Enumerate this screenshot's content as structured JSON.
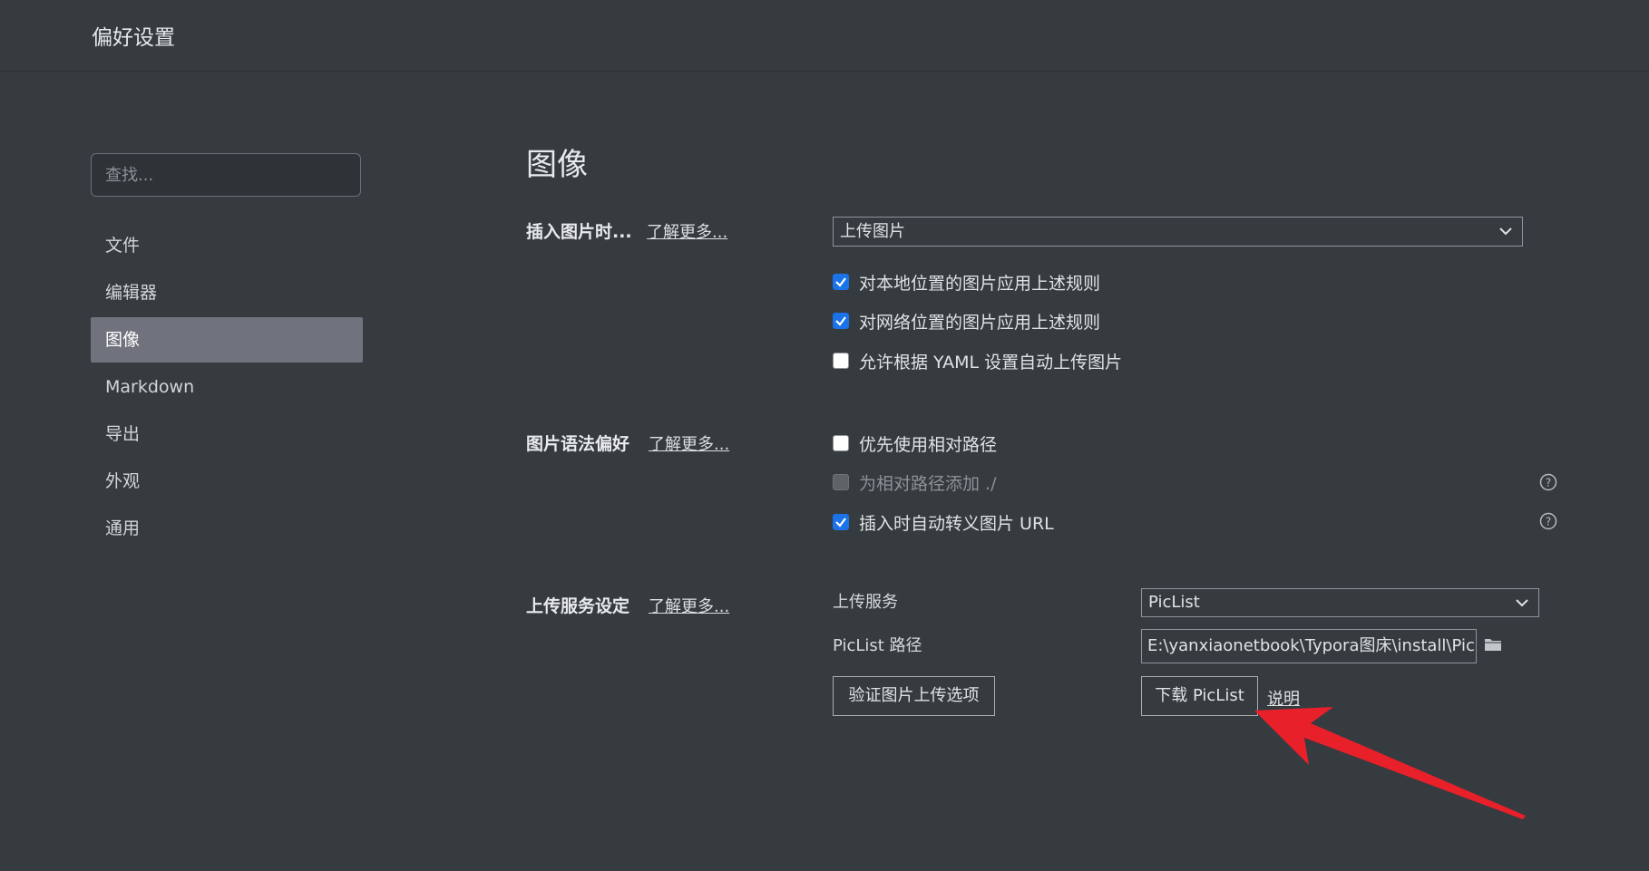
{
  "window": {
    "title": "偏好设置"
  },
  "sidebar": {
    "search_placeholder": "查找...",
    "items": [
      {
        "label": "文件"
      },
      {
        "label": "编辑器"
      },
      {
        "label": "图像",
        "active": true
      },
      {
        "label": "Markdown"
      },
      {
        "label": "导出"
      },
      {
        "label": "外观"
      },
      {
        "label": "通用"
      }
    ]
  },
  "main": {
    "title": "图像",
    "insert": {
      "label": "插入图片时...",
      "learn_more": "了解更多...",
      "action_value": "上传图片",
      "checkboxes": [
        {
          "label": "对本地位置的图片应用上述规则",
          "checked": true
        },
        {
          "label": "对网络位置的图片应用上述规则",
          "checked": true
        },
        {
          "label": "允许根据 YAML 设置自动上传图片",
          "checked": false
        }
      ]
    },
    "syntax": {
      "label": "图片语法偏好",
      "learn_more": "了解更多...",
      "checkboxes": [
        {
          "label": "优先使用相对路径",
          "checked": false
        },
        {
          "label": "为相对路径添加 ./",
          "checked": false,
          "disabled": true
        },
        {
          "label": "插入时自动转义图片 URL",
          "checked": true
        }
      ]
    },
    "upload": {
      "label": "上传服务设定",
      "learn_more": "了解更多...",
      "service_label": "上传服务",
      "service_value": "PicList",
      "path_label": "PicList 路径",
      "path_value": "E:\\yanxiaonetbook\\Typora图床\\install\\PicList\\",
      "verify_button": "验证图片上传选项",
      "download_button": "下载 PicList",
      "explain_link": "说明"
    }
  },
  "colors": {
    "background": "#363b40",
    "active_nav": "#70737d",
    "checkbox_checked": "#1a73e8",
    "annotation_arrow": "#e8202a"
  }
}
